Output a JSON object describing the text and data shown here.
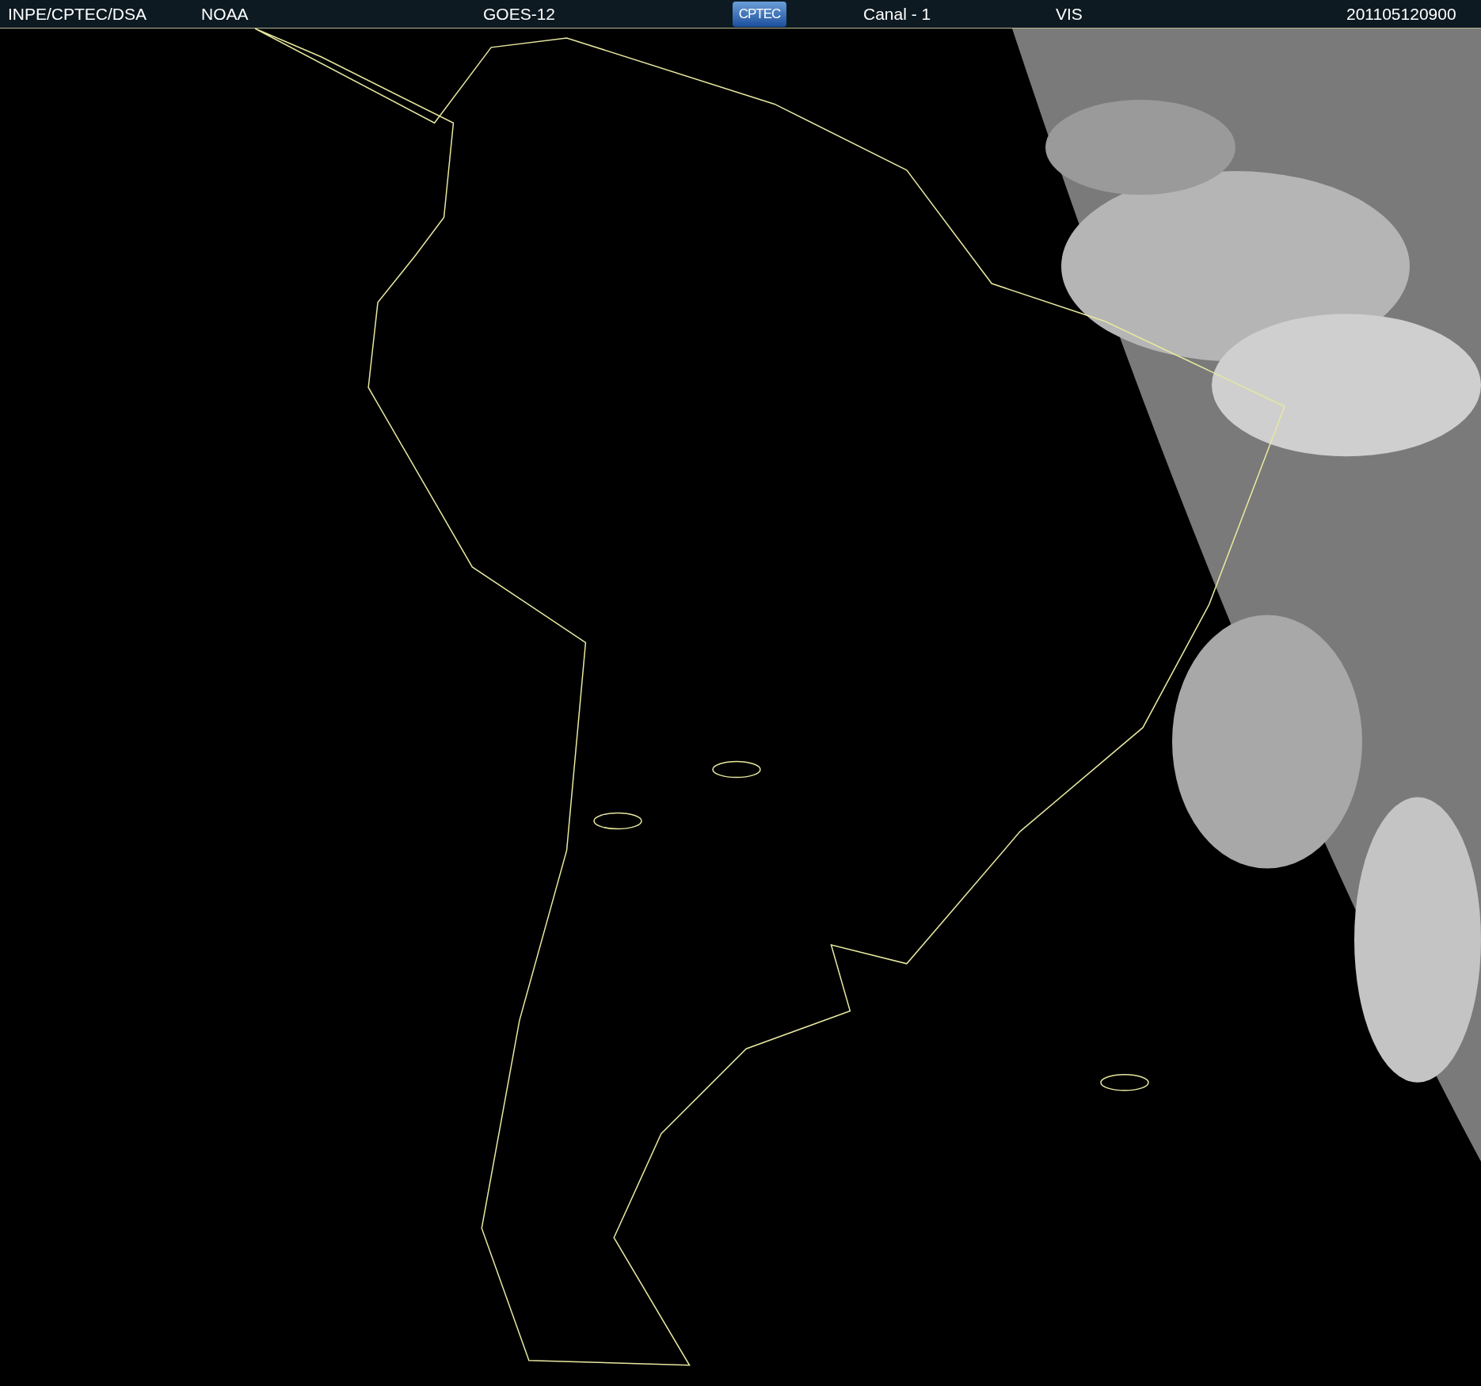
{
  "header": {
    "items": [
      {
        "kind": "text",
        "label": "INPE/CPTEC/DSA"
      },
      {
        "kind": "text",
        "label": "NOAA"
      },
      {
        "kind": "text",
        "label": "GOES-12"
      },
      {
        "kind": "logo",
        "label": "CPTEC"
      },
      {
        "kind": "text",
        "label": "Canal - 1"
      },
      {
        "kind": "text",
        "label": "VIS"
      },
      {
        "kind": "text",
        "label": "201105120900"
      }
    ]
  }
}
